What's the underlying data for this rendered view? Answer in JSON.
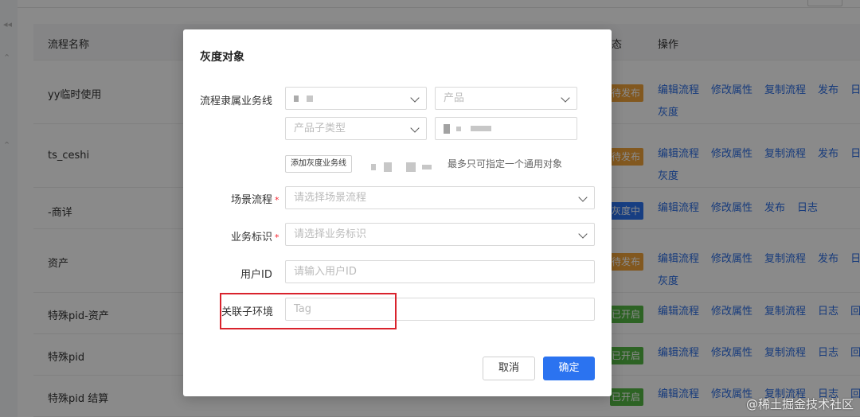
{
  "background": {
    "columns": {
      "name": "流程名称",
      "status_partial": "态",
      "ops": "操作"
    },
    "rows": [
      {
        "name": "yy临时使用",
        "badge": "待发布",
        "badge_color": "#f0a33a",
        "ops": [
          "编辑流程",
          "修改属性",
          "复制流程",
          "发布",
          "日"
        ],
        "ops2": [
          "灰度"
        ]
      },
      {
        "name": "ts_ceshi",
        "badge": "待发布",
        "badge_color": "#f0a33a",
        "ops": [
          "编辑流程",
          "修改属性",
          "复制流程",
          "发布",
          "日"
        ],
        "ops2": [
          "灰度"
        ]
      },
      {
        "name": "-商详",
        "badge": "灰度中",
        "badge_color": "#2b73f0",
        "ops": [
          "编辑流程",
          "修改属性",
          "发布",
          "日志"
        ],
        "ops2": []
      },
      {
        "name": "资产",
        "badge": "待发布",
        "badge_color": "#f0a33a",
        "ops": [
          "编辑流程",
          "修改属性",
          "复制流程",
          "发布",
          "日"
        ],
        "ops2": [
          "灰度"
        ]
      },
      {
        "name": "特殊pid-资产",
        "badge": "已开启",
        "badge_color": "#53b843",
        "ops": [
          "编辑流程",
          "修改属性",
          "复制流程",
          "日志",
          "回"
        ],
        "ops2": []
      },
      {
        "name": "特殊pid",
        "badge": "已开启",
        "badge_color": "#53b843",
        "ops": [
          "编辑流程",
          "修改属性",
          "复制流程",
          "日志",
          "回"
        ],
        "ops2": []
      },
      {
        "name": "特殊pid 结算",
        "badge": "已开启",
        "badge_color": "#53b843",
        "ops": [
          "编辑流程",
          "修改属性",
          "复制流程",
          "日志",
          "回"
        ],
        "ops2": []
      }
    ]
  },
  "dialog": {
    "title": "灰度对象",
    "business_line_label": "流程隶属业务线",
    "business_line_value": "",
    "product_placeholder": "产品",
    "product_subtype_placeholder": "产品子类型",
    "add_button": "添加灰度业务线",
    "hint": "最多只可指定一个通用对象",
    "scene_label": "场景流程",
    "scene_placeholder": "请选择场景流程",
    "biz_id_label": "业务标识",
    "biz_id_placeholder": "请选择业务标识",
    "user_id_label": "用户ID",
    "user_id_placeholder": "请输入用户ID",
    "env_label": "关联子环境",
    "env_placeholder": "Tag",
    "cancel": "取消",
    "ok": "确定"
  },
  "watermark": "@稀土掘金技术社区",
  "colors": {
    "primary": "#2b73f0",
    "required": "#f5222d",
    "highlight": "#d9232d"
  }
}
